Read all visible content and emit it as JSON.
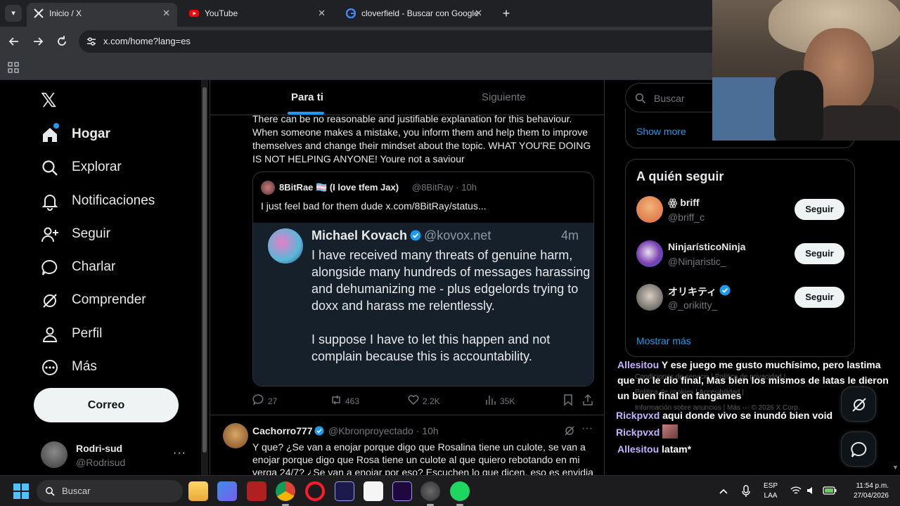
{
  "browser": {
    "tabs": [
      {
        "title": "Inicio / X",
        "active": true
      },
      {
        "title": "YouTube",
        "active": false
      },
      {
        "title": "cloverfield - Buscar con Google",
        "active": false
      }
    ],
    "close_glyph": "✕",
    "new_tab_glyph": "+",
    "url": "x.com/home?lang=es"
  },
  "x": {
    "logo": "𝕏",
    "nav": [
      {
        "label": "Hogar",
        "icon": "home-icon",
        "active": true
      },
      {
        "label": "Explorar",
        "icon": "search-icon"
      },
      {
        "label": "Notificaciones",
        "icon": "bell-icon"
      },
      {
        "label": "Seguir",
        "icon": "add-person-icon"
      },
      {
        "label": "Charlar",
        "icon": "chat-icon"
      },
      {
        "label": "Comprender",
        "icon": "grok-icon"
      },
      {
        "label": "Perfil",
        "icon": "person-icon"
      },
      {
        "label": "Más",
        "icon": "more-circle-icon"
      }
    ],
    "post_button": "Correo",
    "profile": {
      "name": "Rodri-sud",
      "handle": "@Rodrisud",
      "more": "···"
    },
    "timeline_tabs": [
      "Para ti",
      "Siguiente"
    ],
    "tweet1": {
      "text": "There can be no reasonable and justifiable explanation for this behaviour. When someone makes a mistake, you inform them and help them to improve themselves and change their mindset about the topic. WHAT YOU'RE DOING IS NOT HELPING ANYONE! Youre not a saviour",
      "quote": {
        "name": "8BitRae 🏳️‍⚧️ (I love tfem Jax)",
        "handle": "@8BitRay · 10h",
        "text": "I just feel bad for them dude  x.com/8BitRay/status..."
      },
      "image": {
        "name": "Michael Kovach",
        "handle": "@kovox.net",
        "time": "4m",
        "text_1": "I have received many threats of genuine harm, alongside many hundreds of messages harassing and dehumanizing me - plus edgelords trying to doxx and harass me relentlessly.",
        "text_2": "I suppose I have to let this happen and not complain because this is accountability."
      },
      "actions": {
        "replies": "27",
        "reposts": "463",
        "likes": "2.2K",
        "views": "35K"
      }
    },
    "tweet2": {
      "name": "Cachorro777",
      "handle": "@Kbronproyectado · 10h",
      "more": "···",
      "text": "Y que? ¿Se van a enojar porque digo que Rosalina tiene un culote, se van a enojar porque digo que Rosa tiene un culote al que quiero rebotando en mi verga 24/7? ¿Se van a enojar por eso? Escuchen lo que dicen, eso es envidia"
    },
    "search_placeholder": "Buscar",
    "show_more": "Show more",
    "who_to_follow": {
      "title": "A quién seguir",
      "users": [
        {
          "name": "ꙮ briff",
          "handle": "@briff_c",
          "button": "Seguir",
          "color": "#d9653b"
        },
        {
          "name": "NinjarísticoNinja",
          "handle": "@Ninjaristic_",
          "button": "Seguir",
          "color": "#7a3fb0"
        },
        {
          "name": "オリキティ",
          "handle": "@_orikitty_",
          "button": "Seguir",
          "color": "#444444"
        }
      ],
      "more": "Mostrar más"
    },
    "footer": {
      "line1": "Condiciones de servicio  |  Política de privacidad  |",
      "line2": "Política de cookies  |  Accesibilidad  |",
      "line3": "Información sobre anuncios  |  Más ···  © 2026 X Corp."
    }
  },
  "chat": [
    {
      "user": "Allesitou",
      "msg": "Y ese juego me gusto muchísimo, pero lastima que no le dio final, Mas bien los mismos de latas le dieron un buen final en fangames"
    },
    {
      "user": "Rickpvxd",
      "msg": "aqui donde vivo se inundó bien void"
    },
    {
      "user": "Rickpvxd",
      "msg": ""
    },
    {
      "user": "Allesitou",
      "msg": "latam*"
    }
  ],
  "taskbar": {
    "search_placeholder": "Buscar",
    "lang_1": "ESP",
    "lang_2": "LAA",
    "time": "11:54 p.m.",
    "date": "27/04/2026"
  },
  "colors": {
    "accent": "#1d9bf0",
    "background": "#000000",
    "chat_user": "#c5b3ff"
  }
}
